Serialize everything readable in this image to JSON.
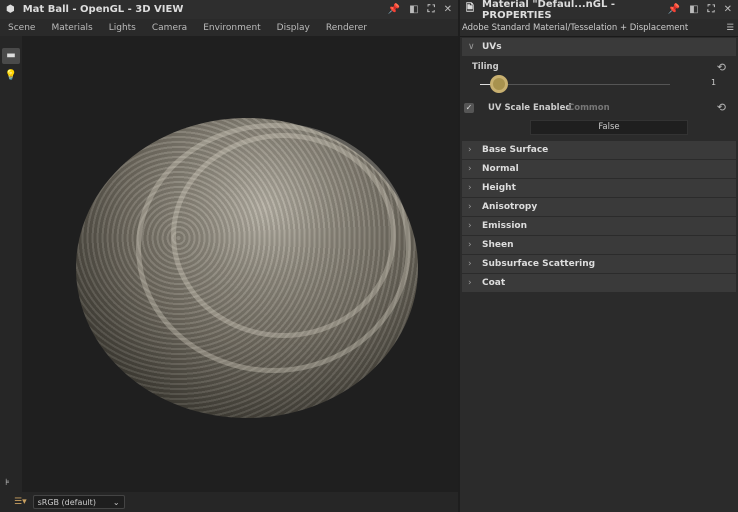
{
  "left_panel": {
    "title": "Mat Ball - OpenGL - 3D VIEW",
    "menu": [
      "Scene",
      "Materials",
      "Lights",
      "Camera",
      "Environment",
      "Display",
      "Renderer"
    ],
    "color_space": "sRGB (default)"
  },
  "right_panel": {
    "title": "Material \"Defaul...nGL - PROPERTIES",
    "subtitle": "Adobe Standard Material/Tesselation + Displacement",
    "uvs": {
      "label": "UVs",
      "tiling_label": "Tiling",
      "tiling_value": "1",
      "uv_scale_label": "UV Scale Enabled",
      "uv_scale_group": "Common",
      "uv_scale_value": "False"
    },
    "sections": [
      "Base Surface",
      "Normal",
      "Height",
      "Anisotropy",
      "Emission",
      "Sheen",
      "Subsurface Scattering",
      "Coat"
    ]
  },
  "colors": {
    "accent": "#a8924e"
  }
}
